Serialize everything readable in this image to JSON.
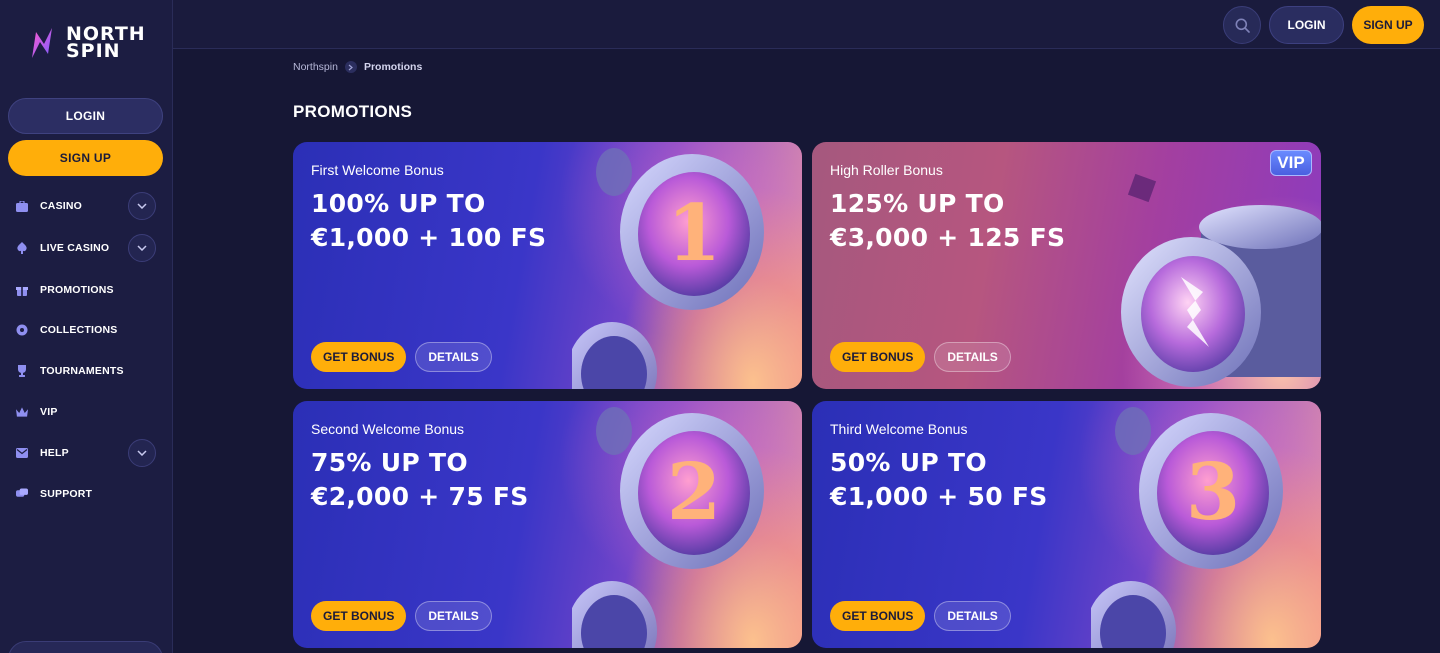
{
  "brand": {
    "line1": "NORTH",
    "line2": "SPIN"
  },
  "sidebar": {
    "login_label": "LOGIN",
    "signup_label": "SIGN UP",
    "items": [
      {
        "label": "CASINO",
        "icon": "briefcase-icon",
        "has_dropdown": true
      },
      {
        "label": "LIVE CASINO",
        "icon": "spade-icon",
        "has_dropdown": true
      },
      {
        "label": "PROMOTIONS",
        "icon": "gift-icon",
        "has_dropdown": false
      },
      {
        "label": "COLLECTIONS",
        "icon": "collections-icon",
        "has_dropdown": false
      },
      {
        "label": "TOURNAMENTS",
        "icon": "trophy-icon",
        "has_dropdown": false
      },
      {
        "label": "VIP",
        "icon": "crown-icon",
        "has_dropdown": false
      },
      {
        "label": "HELP",
        "icon": "mail-icon",
        "has_dropdown": true
      },
      {
        "label": "SUPPORT",
        "icon": "chat-icon",
        "has_dropdown": false
      }
    ]
  },
  "header": {
    "login_label": "LOGIN",
    "signup_label": "SIGN UP"
  },
  "breadcrumb": {
    "home": "Northspin",
    "current": "Promotions"
  },
  "page_title": "PROMOTIONS",
  "promotions": [
    {
      "subtitle": "First Welcome Bonus",
      "line1": "100% UP TO",
      "line2": "€1,000 + 100 FS",
      "coin": "1",
      "get_label": "GET BONUS",
      "details_label": "DETAILS"
    },
    {
      "subtitle": "High Roller Bonus",
      "line1": "125% UP TO",
      "line2": "€3,000 + 125 FS",
      "badge": "VIP",
      "get_label": "GET BONUS",
      "details_label": "DETAILS"
    },
    {
      "subtitle": "Second Welcome Bonus",
      "line1": "75% UP TO",
      "line2": "€2,000 + 75 FS",
      "coin": "2",
      "get_label": "GET BONUS",
      "details_label": "DETAILS"
    },
    {
      "subtitle": "Third Welcome Bonus",
      "line1": "50% UP TO",
      "line2": "€1,000 + 50 FS",
      "coin": "3",
      "get_label": "GET BONUS",
      "details_label": "DETAILS"
    }
  ],
  "colors": {
    "accent": "#ffae0a",
    "background": "#161735",
    "sidebar": "#1c1d42"
  }
}
